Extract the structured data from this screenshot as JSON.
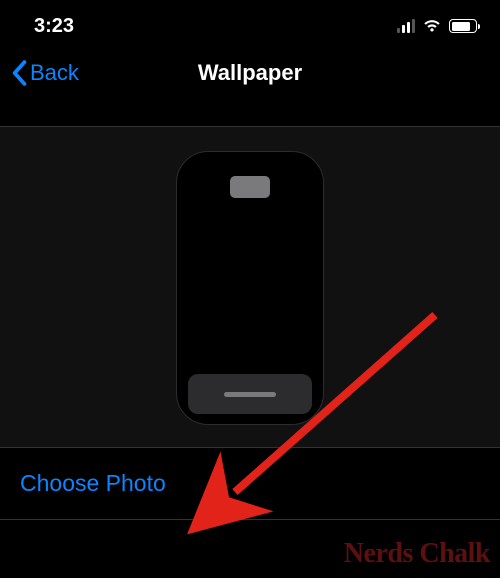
{
  "status": {
    "time": "3:23",
    "battery_pct": 80
  },
  "nav": {
    "back_label": "Back",
    "title": "Wallpaper"
  },
  "actions": {
    "choose_photo": "Choose Photo"
  },
  "watermark": "Nerds Chalk",
  "colors": {
    "accent": "#0a84ff"
  }
}
